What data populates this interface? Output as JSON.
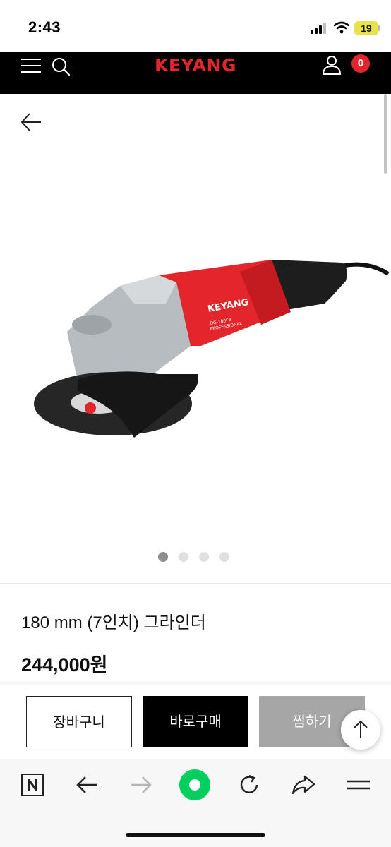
{
  "status": {
    "time": "2:43",
    "battery": "19"
  },
  "header": {
    "logo": "KEYANG",
    "cart_count": "0"
  },
  "product": {
    "image_brand": "KEYANG",
    "image_model": "DG-180FB",
    "image_tag": "PROFESSIONAL",
    "name": "180 mm (7인치) 그라인더",
    "price": "244,000원",
    "carousel_total": 4,
    "carousel_active": 1
  },
  "actions": {
    "cart_label": "장바구니",
    "buy_label": "바로구매",
    "wish_label": "찜하기"
  },
  "browser": {
    "icons": [
      "naver-n-icon",
      "back-icon",
      "forward-icon",
      "home-icon",
      "refresh-icon",
      "share-icon",
      "menu-icon"
    ]
  },
  "colors": {
    "brand_red": "#e3262b",
    "header_bg": "#000000",
    "wish_bg": "#a6a6a6",
    "browser_green": "#03cf5d"
  }
}
